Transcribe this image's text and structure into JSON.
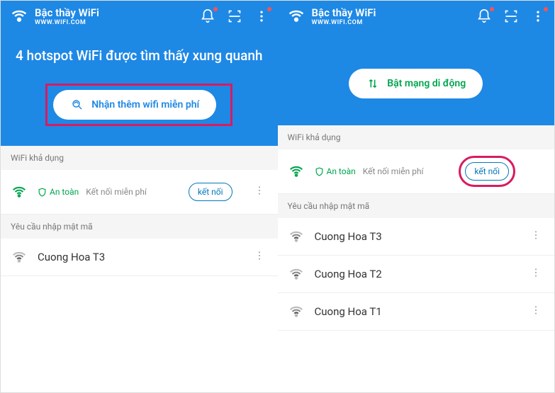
{
  "app": {
    "title": "Bậc thầy WiFi",
    "subtitle": "WWW.WIFI.COM"
  },
  "screen1": {
    "heroTitle": "4 hotspot WiFi được tìm thấy xung quanh",
    "ctaLabel": "Nhận thêm wifi miễn phí",
    "availableLabel": "WiFi khả dụng",
    "safeText": "An toàn",
    "freeConnectText": "Kết nối miễn phí",
    "connectBtn": "kết nối",
    "passwordLabel": "Yêu cầu nhập mật mã",
    "networks": [
      {
        "name": "Cuong Hoa T3"
      }
    ]
  },
  "screen2": {
    "ctaLabel": "Bật mạng di động",
    "availableLabel": "WiFi khả dụng",
    "safeText": "An toàn",
    "freeConnectText": "Kết nối miễn phí",
    "connectBtn": "kết nối",
    "passwordLabel": "Yêu cầu nhập mật mã",
    "networks": [
      {
        "name": "Cuong Hoa T3"
      },
      {
        "name": "Cuong Hoa T2"
      },
      {
        "name": "Cuong Hoa T1"
      }
    ]
  }
}
